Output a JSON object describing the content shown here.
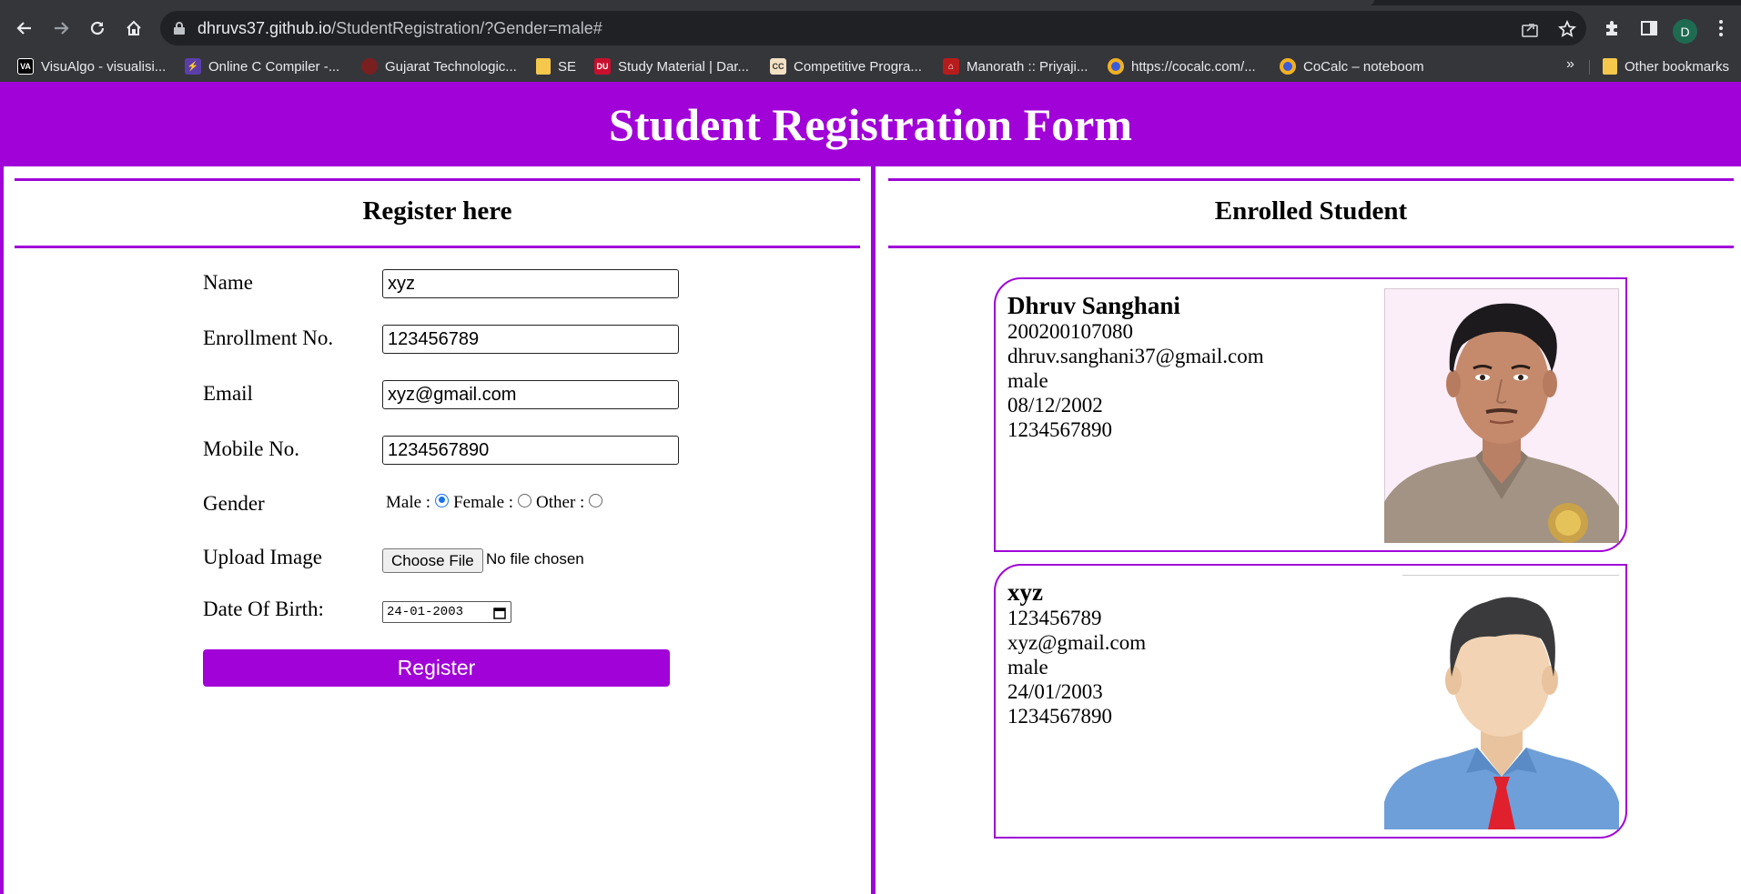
{
  "browser": {
    "url_host": "dhruvs37.github.io",
    "url_path": "/StudentRegistration/?Gender=male#",
    "profile_initial": "D",
    "bookmarks": [
      {
        "label": "VisuAlgo - visualisi...",
        "icon": "visualgo-icon"
      },
      {
        "label": "Online C Compiler -...",
        "icon": "compiler-icon"
      },
      {
        "label": "Gujarat Technologic...",
        "icon": "gtu-icon"
      },
      {
        "label": "SE",
        "icon": "folder-icon"
      },
      {
        "label": "Study Material | Dar...",
        "icon": "darshan-icon"
      },
      {
        "label": "Competitive Progra...",
        "icon": "cc-icon"
      },
      {
        "label": "Manorath :: Priyaji...",
        "icon": "temple-icon"
      },
      {
        "label": "https://cocalc.com/...",
        "icon": "cocalc-icon"
      },
      {
        "label": "CoCalc – noteboom",
        "icon": "cocalc-icon"
      }
    ],
    "more_bookmarks": "»",
    "other_bookmarks": "Other bookmarks"
  },
  "page": {
    "title": "Student Registration Form",
    "accent_color": "#a002d7"
  },
  "form": {
    "heading": "Register here",
    "name_label": "Name",
    "name_value": "xyz",
    "enrollment_label": "Enrollment No.",
    "enrollment_value": "123456789",
    "email_label": "Email",
    "email_value": "xyz@gmail.com",
    "mobile_label": "Mobile No.",
    "mobile_value": "1234567890",
    "gender_label": "Gender",
    "gender_options": [
      "Male :",
      "Female :",
      "Other :"
    ],
    "gender_selected": "Male",
    "upload_label": "Upload Image",
    "choose_file": "Choose File",
    "file_status": "No file chosen",
    "dob_label": "Date Of Birth:",
    "dob_value": "24-01-2003",
    "register_button": "Register"
  },
  "enrolled": {
    "heading": "Enrolled Student",
    "students": [
      {
        "name": "Dhruv Sanghani",
        "enrollment": "200200107080",
        "email": "dhruv.sanghani37@gmail.com",
        "gender": "male",
        "dob": "08/12/2002",
        "mobile": "1234567890",
        "photo": "student-photo"
      },
      {
        "name": "xyz",
        "enrollment": "123456789",
        "email": "xyz@gmail.com",
        "gender": "male",
        "dob": "24/01/2003",
        "mobile": "1234567890",
        "photo": "avatar-illustration"
      }
    ]
  }
}
